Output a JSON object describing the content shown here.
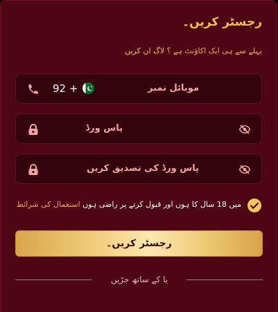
{
  "title": "رجسٹر کریں۔",
  "login_prompt": {
    "text": "پہلے سے ہی ایک اکاؤنٹ ہے ؟",
    "link": "لاگ ان کریں"
  },
  "phone": {
    "label": "موبائل نمبر",
    "country_code": "92 +"
  },
  "password": {
    "label": "پاس ورڈ"
  },
  "confirm_password": {
    "label": "پاس ورڈ کی تصدیق کریں"
  },
  "terms": {
    "text": "میں 18 سال کا ہوں اور قبول کرتے پر راضی ہوں",
    "link": "استعمال کی شرائط"
  },
  "register_button": {
    "label": "رجسٹر کریں۔"
  },
  "divider": {
    "text": "یا کے ساتھ جڑیں"
  },
  "colors": {
    "panel": "#4e0615",
    "field": "#33040d",
    "accent_gold": "#f1c04a",
    "field_label": "#f5a3a3",
    "link": "#f2a06a"
  }
}
